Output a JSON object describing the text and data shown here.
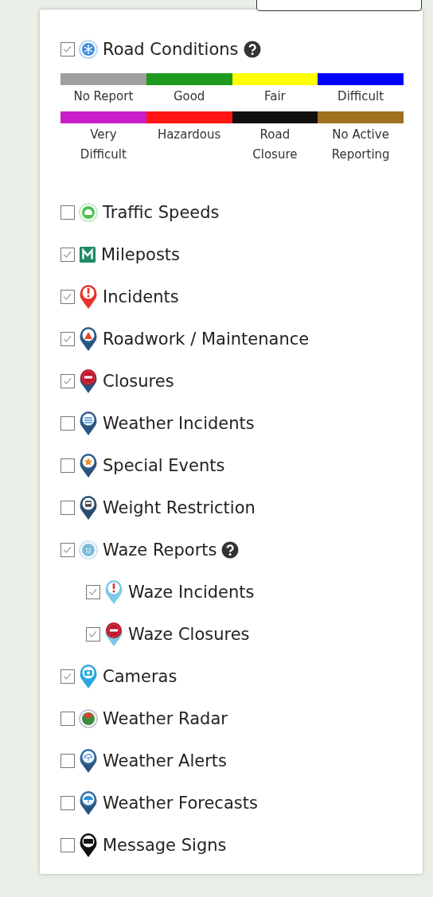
{
  "layers": [
    {
      "label": "Road Conditions",
      "checked": true,
      "kind": "snowflake-circle",
      "help": true,
      "legend": [
        {
          "label": "No Report",
          "color": "#a0a0a0"
        },
        {
          "label": "Good",
          "color": "#1e9a1e"
        },
        {
          "label": "Fair",
          "color": "#ffff00"
        },
        {
          "label": "Difficult",
          "color": "#0000ff"
        },
        {
          "label": "Very Difficult",
          "color": "#c81ec8"
        },
        {
          "label": "Hazardous",
          "color": "#ff1414"
        },
        {
          "label": "Road Closure",
          "color": "#101010"
        },
        {
          "label": "No Active Reporting",
          "color": "#a0701e"
        }
      ]
    },
    {
      "label": "Traffic Speeds",
      "checked": false,
      "kind": "car-circle"
    },
    {
      "label": "Mileposts",
      "checked": true,
      "kind": "m-square"
    },
    {
      "label": "Incidents",
      "checked": true,
      "kind": "pin-exclaim"
    },
    {
      "label": "Roadwork / Maintenance",
      "checked": true,
      "kind": "pin-roadwork"
    },
    {
      "label": "Closures",
      "checked": true,
      "kind": "pin-closure"
    },
    {
      "label": "Weather Incidents",
      "checked": false,
      "kind": "pin-waves"
    },
    {
      "label": "Special Events",
      "checked": false,
      "kind": "pin-star"
    },
    {
      "label": "Weight Restriction",
      "checked": false,
      "kind": "pin-truck"
    },
    {
      "label": "Waze Reports",
      "checked": true,
      "kind": "waze-circle",
      "help": true,
      "children": [
        {
          "label": "Waze Incidents",
          "checked": true,
          "kind": "waze-pin-exclaim"
        },
        {
          "label": "Waze Closures",
          "checked": true,
          "kind": "waze-pin-closure"
        }
      ]
    },
    {
      "label": "Cameras",
      "checked": true,
      "kind": "pin-camera"
    },
    {
      "label": "Weather Radar",
      "checked": false,
      "kind": "radar-circle"
    },
    {
      "label": "Weather Alerts",
      "checked": false,
      "kind": "pin-cloud"
    },
    {
      "label": "Weather Forecasts",
      "checked": false,
      "kind": "pin-umbrella"
    },
    {
      "label": "Message Signs",
      "checked": false,
      "kind": "pin-sign"
    }
  ]
}
